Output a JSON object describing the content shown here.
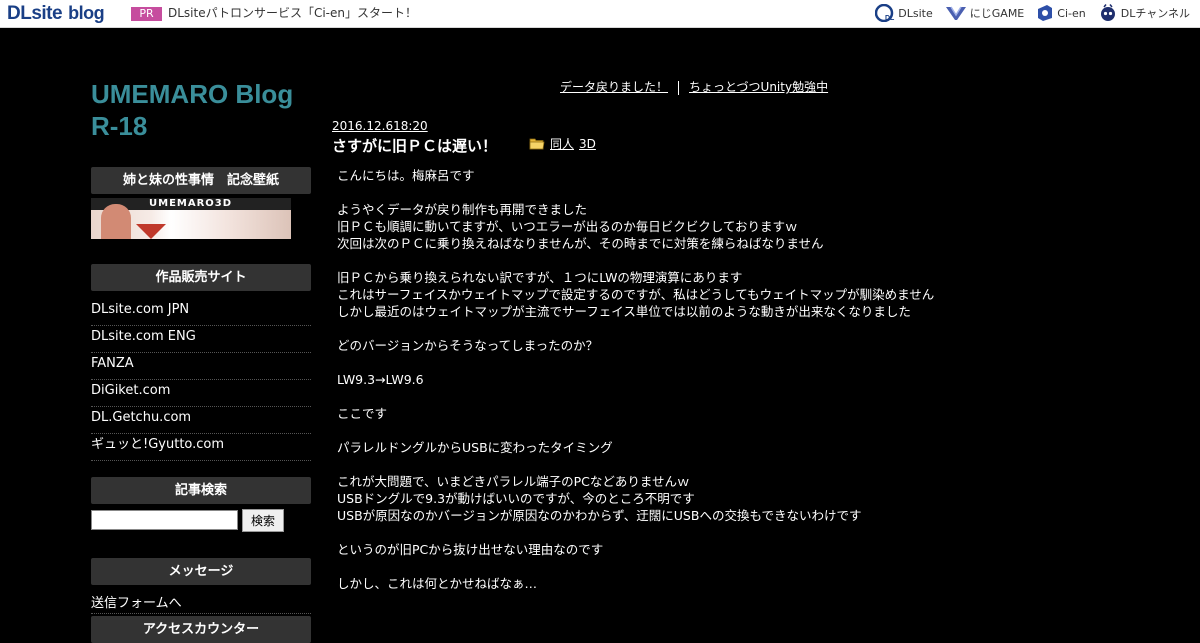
{
  "topbar": {
    "logo_main": "DLsite",
    "logo_sub": "blog",
    "pr_badge": "PR",
    "pr_text": "DLsiteパトロンサービス「Ci-en」スタート！",
    "links": [
      {
        "label": "DLsite",
        "icon": "dlsite-icon"
      },
      {
        "label": "にじGAME",
        "icon": "nijigame-icon"
      },
      {
        "label": "Ci-en",
        "icon": "cien-icon"
      },
      {
        "label": "DLチャンネル",
        "icon": "dlchannel-icon"
      }
    ]
  },
  "sidebar": {
    "blog_title_line1": "UMEMARO Blog",
    "blog_title_line2": "R-18",
    "wallpaper_heading": "姉と妹の性事情　記念壁紙",
    "banner_text": "UMEMARO3D",
    "sales_heading": "作品販売サイト",
    "sales_links": [
      "DLsite.com JPN",
      "DLsite.com ENG",
      "FANZA",
      "DiGiket.com",
      "DL.Getchu.com",
      "ギュッと!Gyutto.com"
    ],
    "search_heading": "記事検索",
    "search_value": "",
    "search_button": "検索",
    "message_heading": "メッセージ",
    "message_link": "送信フォームへ",
    "counter_heading": "アクセスカウンター"
  },
  "main": {
    "prev_link": "データ戻りました！",
    "next_link": "ちょっとづつUnity勉強中",
    "date": "2016.12.618:20",
    "title": "さすがに旧ＰＣは遅い！",
    "categories": [
      "同人",
      "3D"
    ],
    "body": [
      "こんにちは。梅麻呂です",
      "",
      "ようやくデータが戻り制作も再開できました",
      "旧ＰＣも順調に動いてますが、いつエラーが出るのか毎日ビクビクしておりますｗ",
      "次回は次のＰＣに乗り換えねばなりませんが、その時までに対策を練らねばなりません",
      "",
      "旧ＰＣから乗り換えられない訳ですが、１つにLWの物理演算にあります",
      "これはサーフェイスかウェイトマップで設定するのですが、私はどうしてもウェイトマップが馴染めません",
      "しかし最近のはウェイトマップが主流でサーフェイス単位では以前のような動きが出来なくなりました",
      "",
      "どのバージョンからそうなってしまったのか？",
      "",
      "LW9.3→LW9.6",
      "",
      "ここです",
      "",
      "パラレルドングルからUSBに変わったタイミング",
      "",
      "これが大問題で、いまどきパラレル端子のPCなどありませんｗ",
      "USBドングルで9.3が動けばいいのですが、今のところ不明です",
      "USBが原因なのかバージョンが原因なのかわからず、迂闊にUSBへの交換もできないわけです",
      "",
      "というのが旧PCから抜け出せない理由なのです",
      "",
      "しかし、これは何とかせねばなぁ…"
    ]
  },
  "colors": {
    "background": "#000000",
    "title_accent": "#3a8e9a",
    "pr_badge": "#c64d9e",
    "logo": "#1a3f86"
  }
}
